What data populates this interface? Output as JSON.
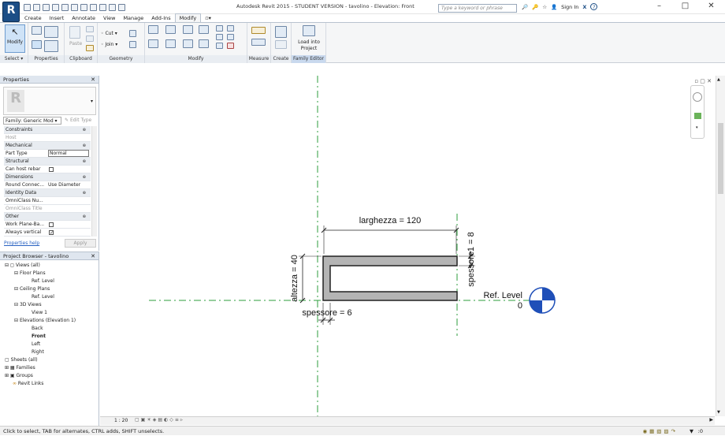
{
  "app": {
    "title": "Autodesk Revit 2015 -  STUDENT VERSION -     tavolino - Elevation: Front",
    "search_placeholder": "Type a keyword or phrase",
    "sign_in": "Sign In",
    "logo_letter": "R"
  },
  "ribbon": {
    "tabs": [
      "Create",
      "Insert",
      "Annotate",
      "View",
      "Manage",
      "Add-Ins",
      "Modify"
    ],
    "active_tab": "Modify",
    "modify_label": "Modify",
    "cut_label": "Cut",
    "join_label": "Join",
    "paste_label": "Paste",
    "load_label": "Load into Project",
    "groups": [
      "Select",
      "Properties",
      "Clipboard",
      "Geometry",
      "Modify",
      "Measure",
      "Create",
      "Family Editor"
    ]
  },
  "properties": {
    "title": "Properties",
    "family_selector": "Family: Generic Mod",
    "edit_type": "Edit Type",
    "rows": [
      {
        "k": "Constraints",
        "cat": true
      },
      {
        "k": "Host",
        "v": ""
      },
      {
        "k": "Mechanical",
        "cat": true
      },
      {
        "k": "Part Type",
        "v": "Normal"
      },
      {
        "k": "Structural",
        "cat": true
      },
      {
        "k": "Can host rebar",
        "v": ""
      },
      {
        "k": "Dimensions",
        "cat": true
      },
      {
        "k": "Round Connec...",
        "v": "Use Diameter"
      },
      {
        "k": "Identity Data",
        "cat": true
      },
      {
        "k": "OmniClass Nu...",
        "v": ""
      },
      {
        "k": "OmniClass Title",
        "v": ""
      },
      {
        "k": "Other",
        "cat": true
      },
      {
        "k": "Work Plane-Ba...",
        "v": ""
      },
      {
        "k": "Always vertical",
        "v": ""
      }
    ],
    "help_link": "Properties help",
    "apply": "Apply"
  },
  "project_browser": {
    "title": "Project Browser - tavolino",
    "nodes": [
      "Views (all)",
      "Floor Plans",
      "Ref. Level",
      "Ceiling Plans",
      "Ref. Level",
      "3D Views",
      "View 1",
      "Elevations (Elevation 1)",
      "Back",
      "Front",
      "Left",
      "Right",
      "Sheets (all)",
      "Families",
      "Groups",
      "Revit Links"
    ]
  },
  "drawing": {
    "dim_width": "larghezza = 120",
    "dim_height": "altezza = 40",
    "dim_thick1": "spessore1 = 8",
    "dim_thick": "spessore = 6",
    "level_name": "Ref. Level",
    "level_value": "0"
  },
  "view_bar": {
    "scale": "1 : 20"
  },
  "status": {
    "text": "Click to select, TAB for alternates, CTRL adds, SHIFT unselects.",
    "filter_count": ":0"
  },
  "colors": {
    "ref_plane": "#2e9e3e",
    "accent": "#1c4e86",
    "level_marker": "#1f4fb8"
  }
}
